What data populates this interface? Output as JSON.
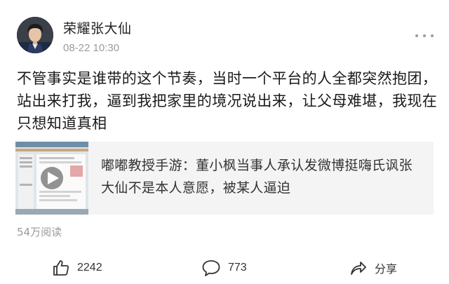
{
  "author": {
    "name": "荣耀张大仙",
    "avatar_icon": "avatar-photo"
  },
  "post": {
    "timestamp": "08-22 10:30",
    "text": "不管事实是谁带的这个节奏，当时一个平台的人全都突然抱团，站出来打我，逼到我把家里的境况说出来，让父母难堪，我现在只想知道真相",
    "more_icon": "more-dots-icon"
  },
  "shared_card": {
    "thumbnail_icon": "video-play-icon",
    "text": "嘟嘟教授手游：董小枫当事人承认发微博挺嗨氏讽张大仙不是本人意愿，被某人逼迫"
  },
  "stats": {
    "read_count": "54万阅读"
  },
  "actions": {
    "like": {
      "icon": "thumbs-up-icon",
      "count": "2242"
    },
    "comment": {
      "icon": "comment-bubble-icon",
      "count": "773"
    },
    "share": {
      "icon": "share-arrow-icon",
      "label": "分享"
    }
  },
  "colors": {
    "text_primary": "#1a1a1a",
    "text_secondary": "#9a9a9a",
    "card_background": "#f4f4f4",
    "page_background": "#ffffff"
  }
}
